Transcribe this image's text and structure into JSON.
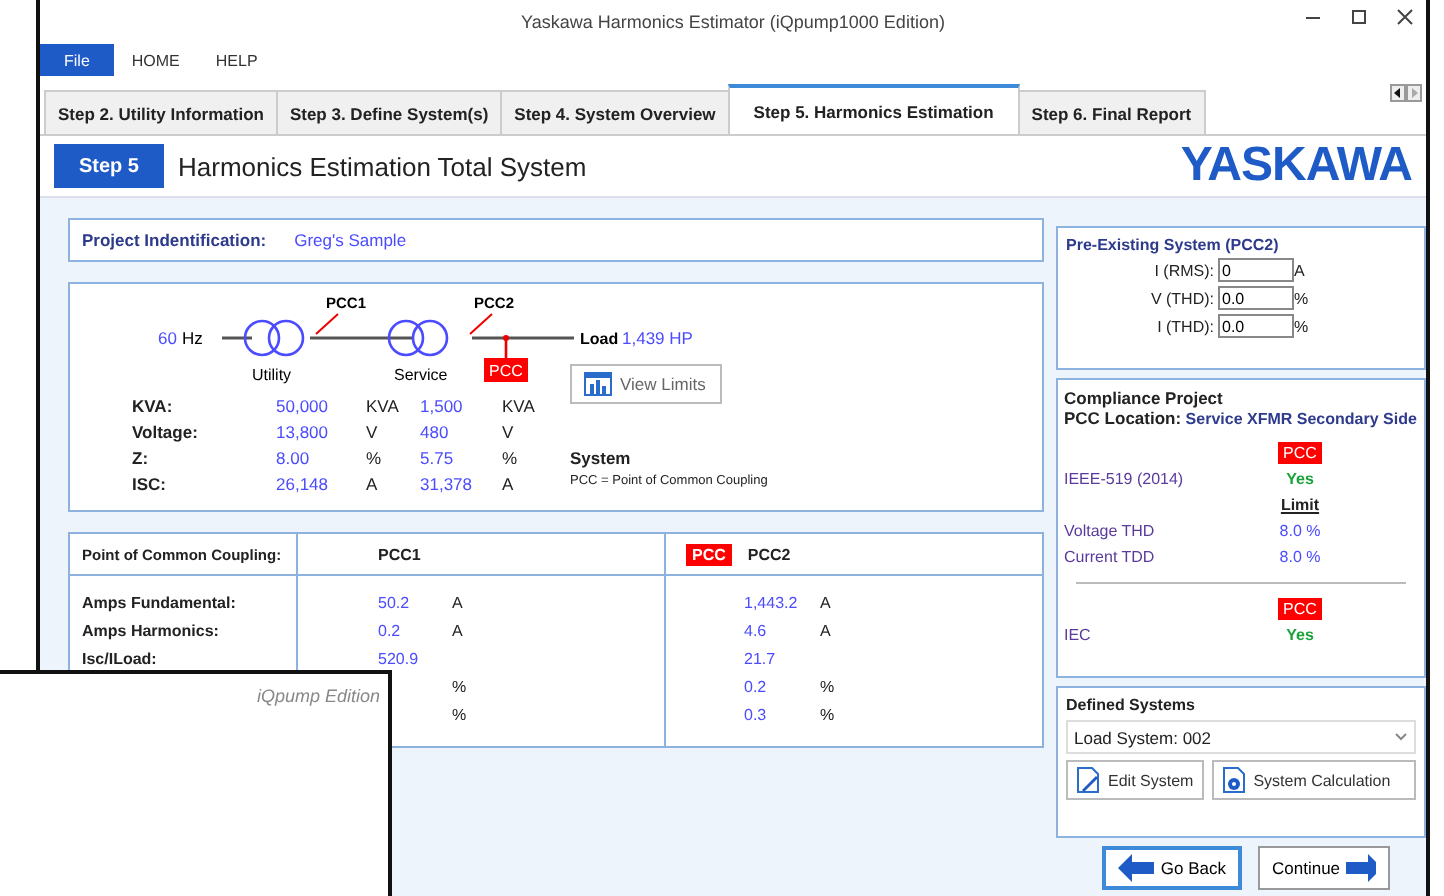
{
  "window": {
    "title": "Yaskawa Harmonics Estimator (iQpump1000 Edition)"
  },
  "menu": [
    {
      "label": "File",
      "selected": true
    },
    {
      "label": "HOME",
      "selected": false
    },
    {
      "label": "HELP",
      "selected": false
    }
  ],
  "tabs": [
    {
      "label": "Step 2. Utility Information",
      "selected": false
    },
    {
      "label": "Step 3. Define System(s)",
      "selected": false
    },
    {
      "label": "Step 4. System Overview",
      "selected": false
    },
    {
      "label": "Step 5. Harmonics Estimation",
      "selected": true
    },
    {
      "label": "Step 6. Final Report",
      "selected": false
    }
  ],
  "header": {
    "step": "Step 5",
    "title": "Harmonics Estimation Total System",
    "logo": "YASKAWA"
  },
  "project": {
    "label": "Project Indentification:",
    "value": "Greg's Sample"
  },
  "diagram": {
    "frequency": "60",
    "frequency_unit": "Hz",
    "pcc1": "PCC1",
    "pcc2": "PCC2",
    "pcc_tag": "PCC",
    "load_label": "Load",
    "load_value": "1,439 HP",
    "utility": "Utility",
    "service": "Service",
    "view_limits": "View Limits",
    "system_title": "System",
    "system_note": "PCC = Point of Common Coupling",
    "rows": [
      {
        "label": "KVA:",
        "utility": "50,000",
        "utility_unit": "KVA",
        "service": "1,500",
        "service_unit": "KVA"
      },
      {
        "label": "Voltage:",
        "utility": "13,800",
        "utility_unit": "V",
        "service": "480",
        "service_unit": "V"
      },
      {
        "label": "Z:",
        "utility": "8.00",
        "utility_unit": "%",
        "service": "5.75",
        "service_unit": "%"
      },
      {
        "label": "ISC:",
        "utility": "26,148",
        "utility_unit": "A",
        "service": "31,378",
        "service_unit": "A"
      }
    ]
  },
  "coupling": {
    "label": "Point of Common Coupling:",
    "pcc1": "PCC1",
    "pcc_tag": "PCC",
    "pcc2": "PCC2",
    "rows": [
      {
        "label": "Amps Fundamental:",
        "pcc1": "50.2",
        "pcc1_unit": "A",
        "pcc2": "1,443.2",
        "pcc2_unit": "A"
      },
      {
        "label": "Amps Harmonics:",
        "pcc1": "0.2",
        "pcc1_unit": "A",
        "pcc2": "4.6",
        "pcc2_unit": "A"
      },
      {
        "label": "Isc/ILoad:",
        "pcc1": "520.9",
        "pcc2": "21.7"
      },
      {
        "pcc1_unit": "%",
        "pcc2": "0.2",
        "pcc2_unit": "%"
      },
      {
        "pcc1_unit": "%",
        "pcc2": "0.3",
        "pcc2_unit": "%"
      }
    ]
  },
  "pre_existing": {
    "title": "Pre-Existing System (PCC2)",
    "fields": [
      {
        "label": "I (RMS):",
        "value": "0",
        "unit": "A"
      },
      {
        "label": "V (THD):",
        "value": "0.0",
        "unit": "%"
      },
      {
        "label": "I (THD):",
        "value": "0.0",
        "unit": "%"
      }
    ]
  },
  "compliance": {
    "title": "Compliance Project",
    "location_label": "PCC Location:",
    "location": "Service XFMR Secondary Side",
    "pcc_tag": "PCC",
    "standard": "IEEE-519 (2014)",
    "standard_result": "Yes",
    "limit_heading": "Limit",
    "limits": [
      {
        "label": "Voltage THD",
        "value": "8.0 %"
      },
      {
        "label": "Current TDD",
        "value": "8.0 %"
      }
    ],
    "iec_tag": "PCC",
    "iec": "IEC",
    "iec_result": "Yes"
  },
  "defined_systems": {
    "title": "Defined Systems",
    "selection": "Load System: 002",
    "edit": "Edit System",
    "calculate": "System Calculation"
  },
  "nav": {
    "back": "Go Back",
    "continue": "Continue"
  },
  "overlay": {
    "caption": "iQpump Edition"
  }
}
